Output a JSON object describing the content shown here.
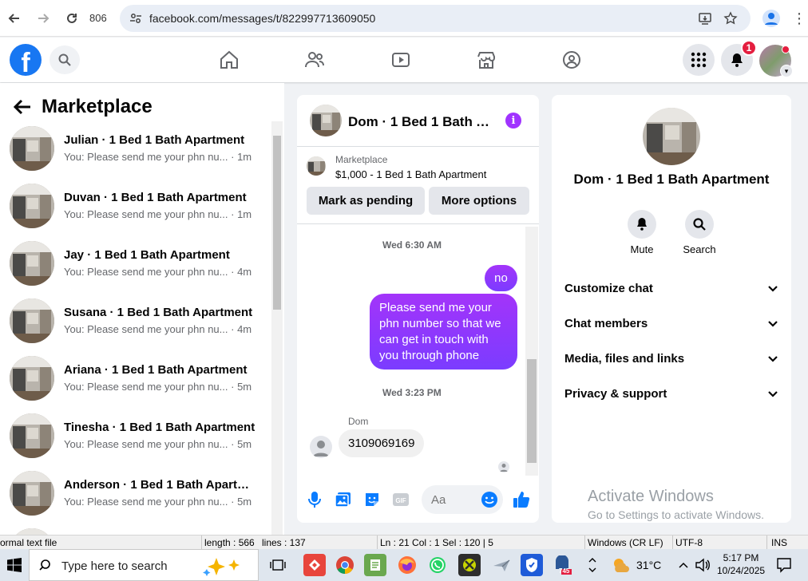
{
  "browser": {
    "tab_count": "806",
    "url": "facebook.com/messages/t/822997713609050"
  },
  "fb_header": {
    "notification_count": "1"
  },
  "left_panel": {
    "title": "Marketplace",
    "conversations": [
      {
        "name": "Julian · 1 Bed 1 Bath Apartment",
        "preview": "You: Please send me your phn nu...",
        "time": "· 1m"
      },
      {
        "name": "Duvan · 1 Bed 1 Bath Apartment",
        "preview": "You: Please send me your phn nu...",
        "time": "· 1m"
      },
      {
        "name": "Jay · 1 Bed 1 Bath Apartment",
        "preview": "You: Please send me your phn nu...",
        "time": "· 4m"
      },
      {
        "name": "Susana · 1 Bed 1 Bath Apartment",
        "preview": "You: Please send me your phn nu...",
        "time": "· 4m"
      },
      {
        "name": "Ariana · 1 Bed 1 Bath Apartment",
        "preview": "You: Please send me your phn nu...",
        "time": "· 5m"
      },
      {
        "name": "Tinesha · 1 Bed 1 Bath Apartment",
        "preview": "You: Please send me your phn nu...",
        "time": "· 5m"
      },
      {
        "name": "Anderson · 1 Bed 1 Bath Apartm...",
        "preview": "You: Please send me your phn nu...",
        "time": "· 5m"
      },
      {
        "name": "",
        "preview": "",
        "time": ""
      }
    ]
  },
  "chat": {
    "title": "Dom · 1 Bed 1 Bath A...",
    "marketplace_label": "Marketplace",
    "listing": "$1,000 - 1 Bed 1 Bath Apartment",
    "mark_pending": "Mark as pending",
    "more_options": "More options",
    "timestamp1": "Wed 6:30 AM",
    "msg_no": "no",
    "msg_long": "Please send me your phn number so that we can get in touch with you through phone",
    "timestamp2": "Wed 3:23 PM",
    "sender": "Dom",
    "msg_in": "3109069169",
    "composer_placeholder": "Aa"
  },
  "details": {
    "title": "Dom · 1 Bed 1 Bath Apartment",
    "mute": "Mute",
    "search": "Search",
    "rows": [
      "Customize chat",
      "Chat members",
      "Media, files and links",
      "Privacy & support"
    ],
    "watermark_title": "Activate Windows",
    "watermark_sub": "Go to Settings to activate Windows."
  },
  "statusbar": {
    "mode": "ormal text file",
    "length": "length : 566",
    "lines": "lines : 137",
    "pos": "Ln : 21    Col : 1    Sel : 120 | 5",
    "eol": "Windows (CR LF)",
    "enc": "UTF-8",
    "ins": "INS"
  },
  "taskbar": {
    "search_placeholder": "Type here to search",
    "temperature": "31°C",
    "time": "5:17 PM",
    "date": "10/24/2025",
    "badge": "745"
  },
  "colors": {
    "fb_blue": "#1877f2",
    "messenger_purple": "#a033ff",
    "notif_red": "#e41e3f"
  }
}
